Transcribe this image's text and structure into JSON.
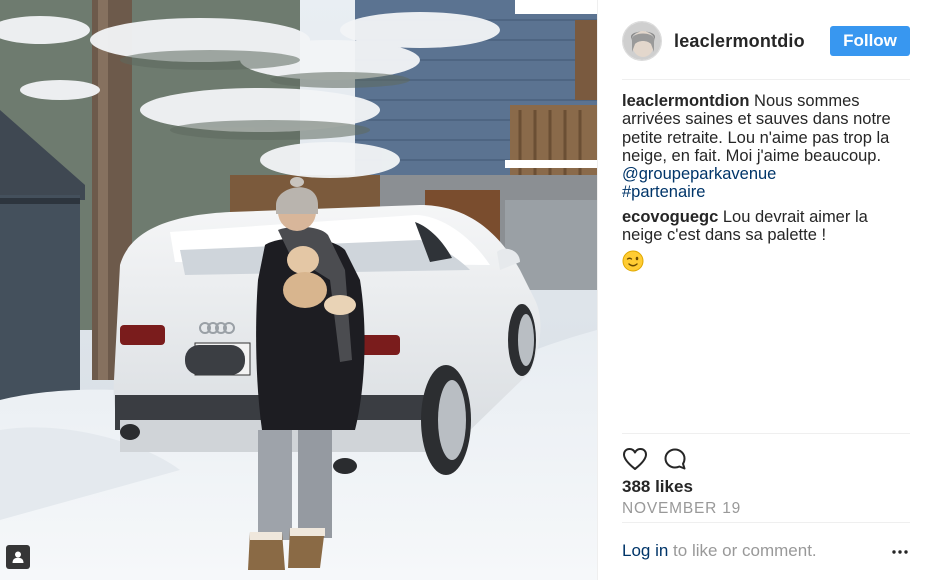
{
  "post": {
    "author": "leaclermontdio",
    "follow_label": "Follow",
    "user_tag_icon": "user-tag-icon"
  },
  "comments": [
    {
      "username": "leaclermontdion",
      "text": "Nous sommes arrivées saines et sauves dans notre petite retraite. Lou n'aime pas trop la neige, en fait. Moi j'aime beaucoup.",
      "mention": "@groupeparkavenue",
      "hashtag": "#partenaire"
    },
    {
      "username": "ecovoguegc",
      "text": "Lou devrait aimer la neige c'est dans sa palette !",
      "emoji": "winking-face"
    }
  ],
  "actions": {
    "like_icon": "heart-icon",
    "comment_icon": "comment-bubble-icon"
  },
  "likes": "388 likes",
  "date": "NOVEMBER 19",
  "login": {
    "link": "Log in",
    "text": " to like or comment.",
    "more_icon": "more-options-icon"
  },
  "colors": {
    "follow_button": "#3897f0",
    "link": "#003569",
    "muted": "#999999",
    "text": "#262626",
    "divider": "#efefef"
  }
}
